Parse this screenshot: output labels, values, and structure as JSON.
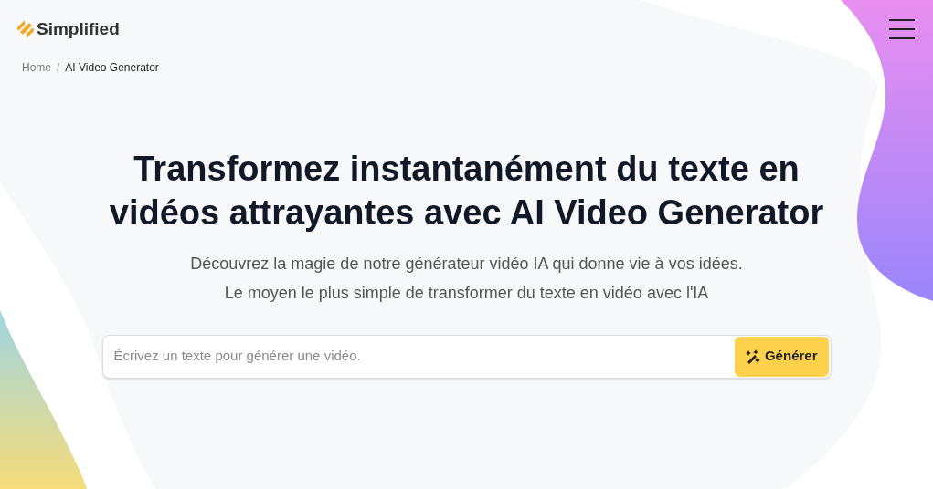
{
  "header": {
    "logo_text": "Simplified"
  },
  "breadcrumb": [
    {
      "label": "Home",
      "selected": false
    },
    {
      "label": "AI Video Generator",
      "selected": true
    }
  ],
  "breadcrumb_separator": "/",
  "hero": {
    "title": "Transformez instantanément du texte en vidéos attrayantes avec AI Video Generator",
    "subtitle": "Découvrez la magie de notre générateur vidéo IA qui donne vie à vos idées. Le moyen le plus simple de transformer du texte en vidéo avec l'IA"
  },
  "prompt": {
    "placeholder": "Écrivez un texte pour générer une vidéo.",
    "button": "Générer"
  }
}
